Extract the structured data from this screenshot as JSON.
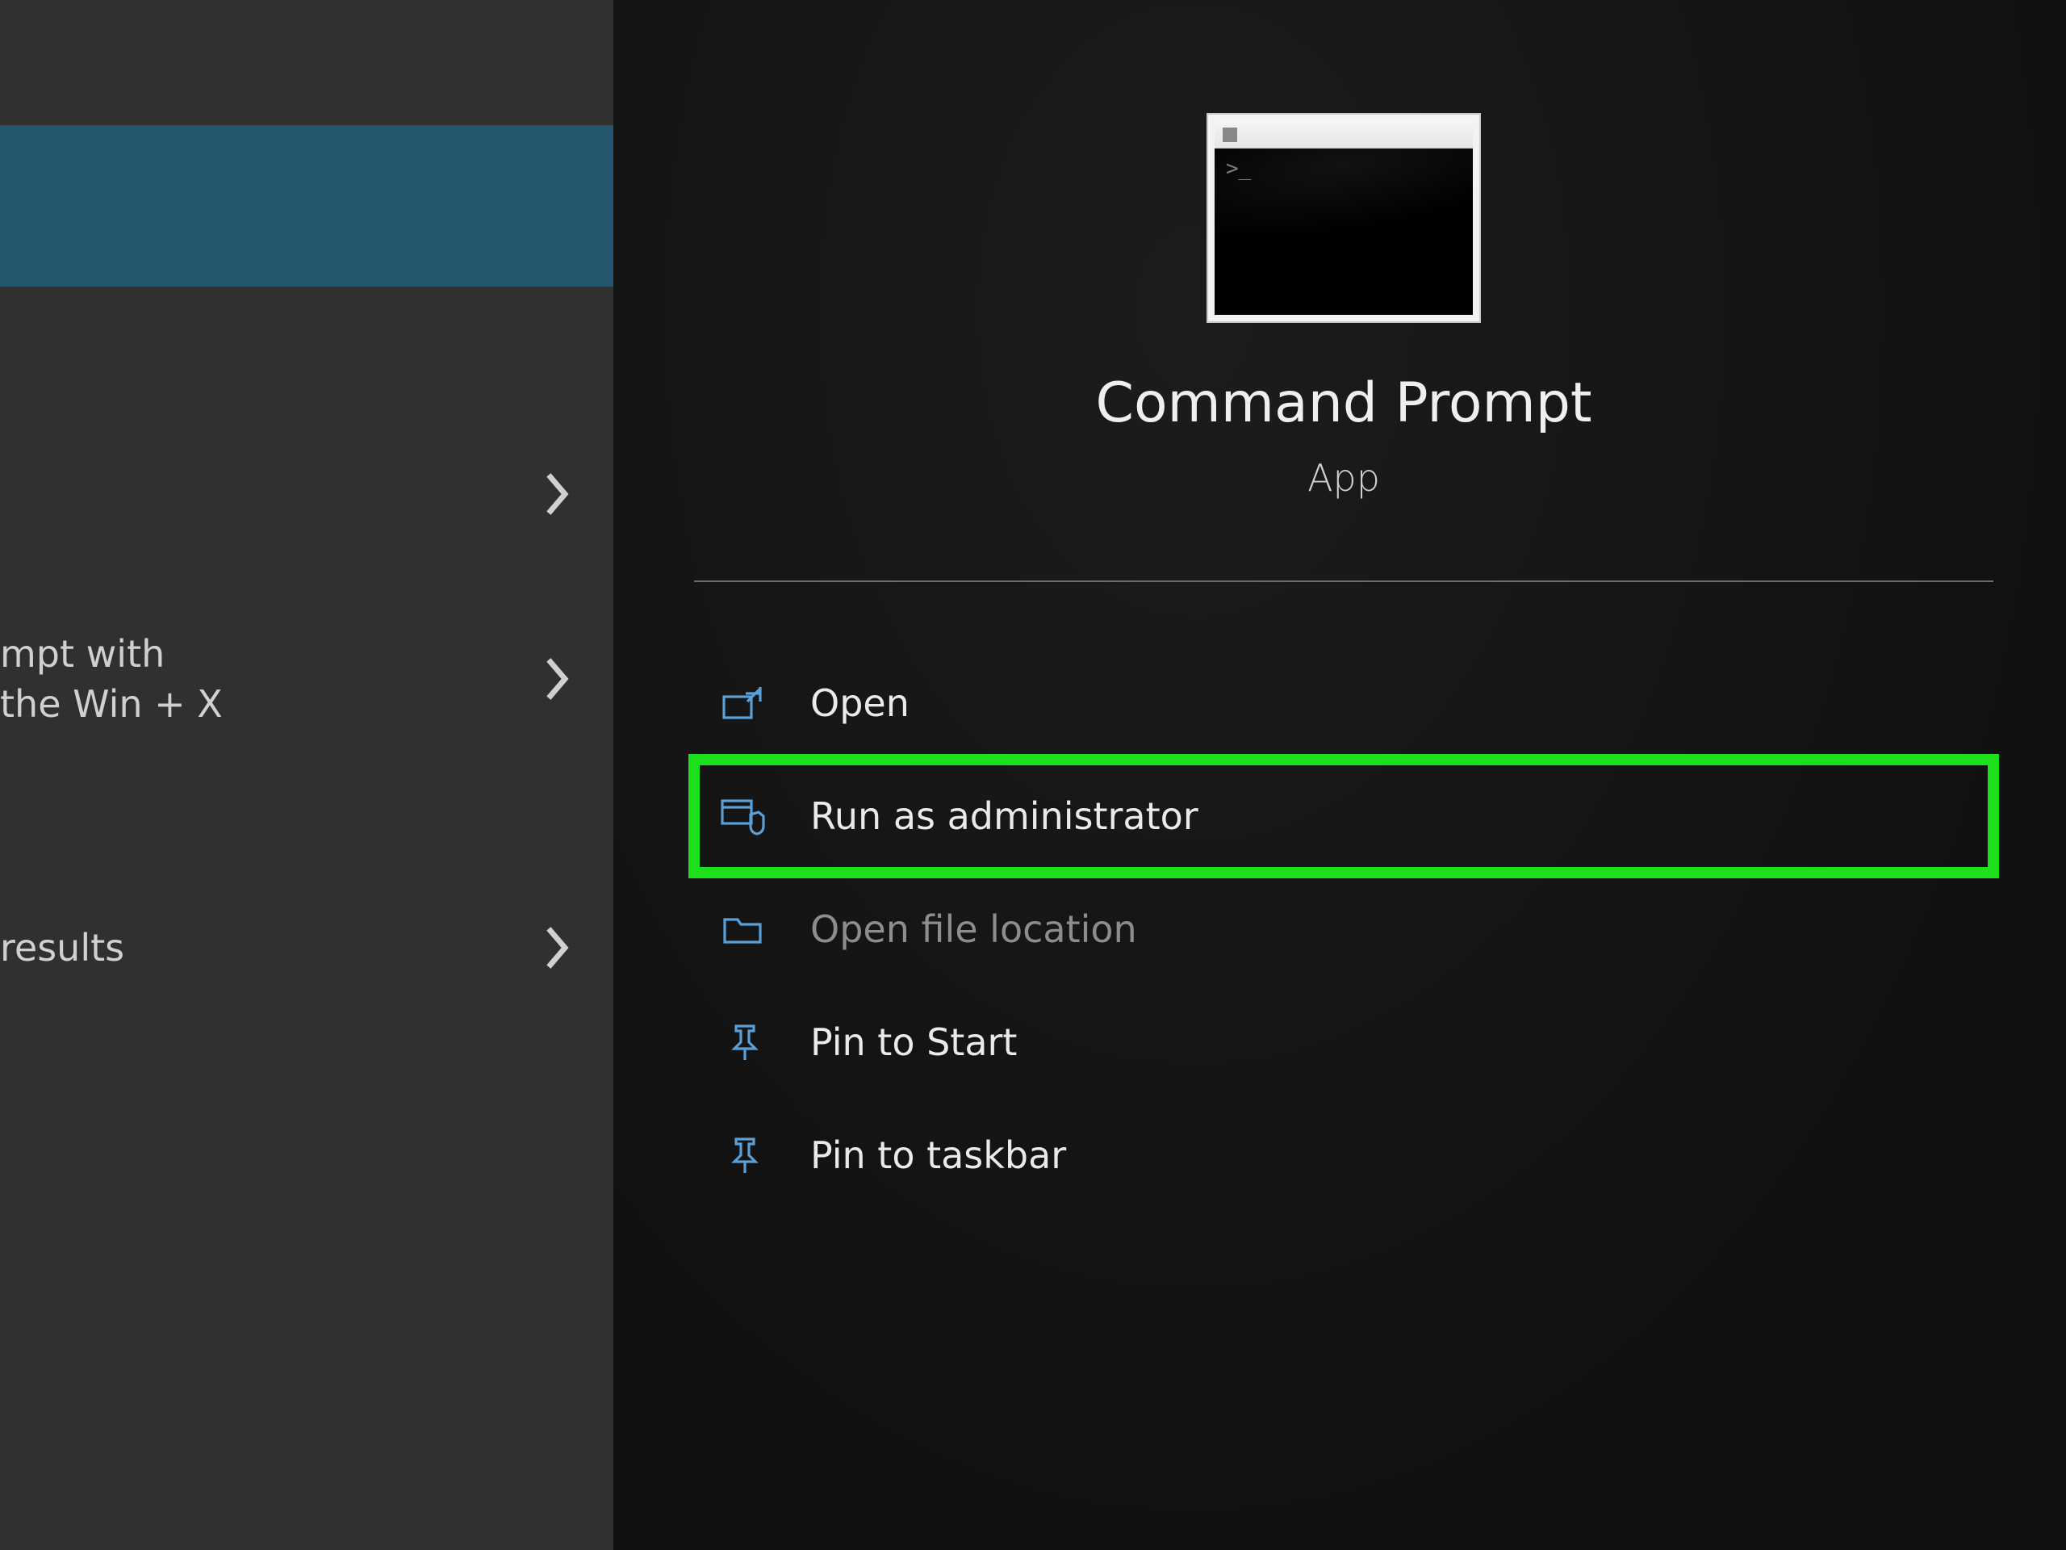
{
  "left": {
    "item1_text": "",
    "item2_text": "mpt with\nthe Win + X",
    "item3_text": "results"
  },
  "detail": {
    "title": "Command Prompt",
    "subtitle": "App",
    "actions": [
      {
        "label": "Open",
        "icon": "open-window-icon"
      },
      {
        "label": "Run as administrator",
        "icon": "shield-window-icon"
      },
      {
        "label": "Open file location",
        "icon": "folder-icon"
      },
      {
        "label": "Pin to Start",
        "icon": "pin-icon"
      },
      {
        "label": "Pin to taskbar",
        "icon": "pin-icon"
      }
    ],
    "highlight_index": 1
  }
}
